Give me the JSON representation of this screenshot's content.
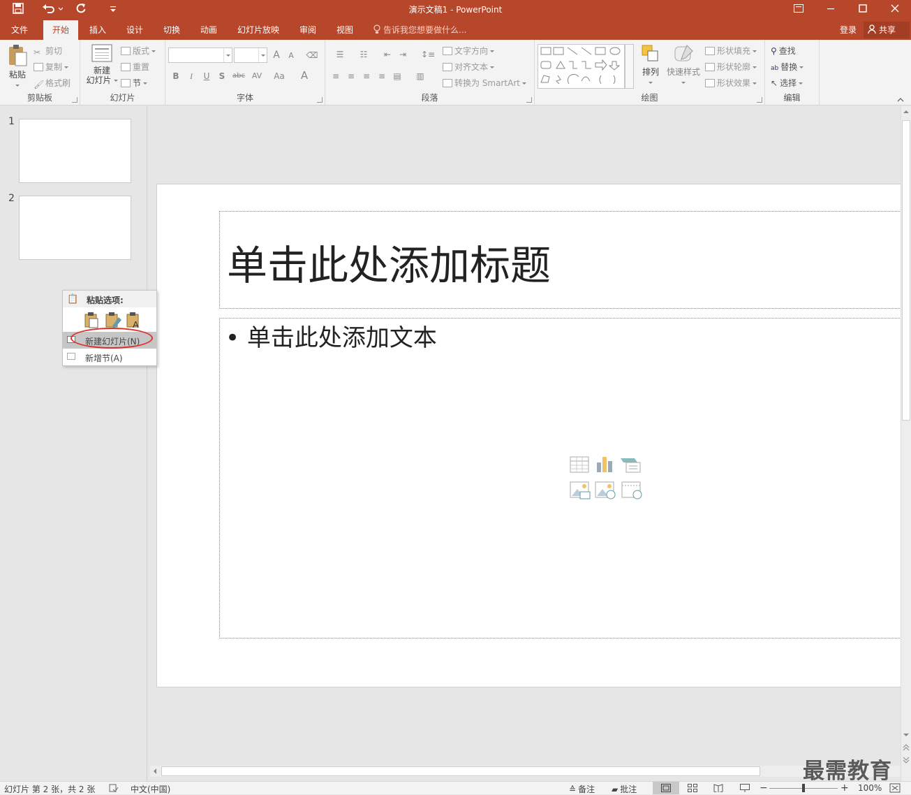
{
  "window": {
    "title": "演示文稿1 - PowerPoint"
  },
  "qat": {
    "save_icon": "save-icon",
    "undo_icon": "undo-icon",
    "redo_icon": "redo-icon",
    "customize_icon": "chevron-down-icon"
  },
  "tabs": [
    {
      "label": "文件"
    },
    {
      "label": "开始"
    },
    {
      "label": "插入"
    },
    {
      "label": "设计"
    },
    {
      "label": "切换"
    },
    {
      "label": "动画"
    },
    {
      "label": "幻灯片放映"
    },
    {
      "label": "审阅"
    },
    {
      "label": "视图"
    }
  ],
  "tellme": {
    "placeholder": "告诉我您想要做什么..."
  },
  "account": {
    "login": "登录",
    "share": "共享"
  },
  "ribbon": {
    "clipboard": {
      "label": "剪贴板",
      "paste": "粘贴",
      "cut": "剪切",
      "copy": "复制",
      "format_painter": "格式刷"
    },
    "slides": {
      "label": "幻灯片",
      "new_slide_line1": "新建",
      "new_slide_line2": "幻灯片",
      "layout": "版式",
      "reset": "重置",
      "section": "节"
    },
    "font": {
      "label": "字体",
      "bold": "B",
      "italic": "I",
      "underline": "U",
      "shadow": "S",
      "strike": "abc",
      "spacing": "AV",
      "case": "Aa",
      "color": "A",
      "grow": "A",
      "shrink": "A"
    },
    "paragraph": {
      "label": "段落",
      "text_direction": "文字方向",
      "align_text": "对齐文本",
      "smartart": "转换为 SmartArt"
    },
    "drawing": {
      "label": "绘图",
      "arrange": "排列",
      "quick_styles": "快速样式",
      "shape_fill": "形状填充",
      "shape_outline": "形状轮廓",
      "shape_effects": "形状效果"
    },
    "editing": {
      "label": "编辑",
      "find": "查找",
      "replace": "替换",
      "select": "选择"
    }
  },
  "slides_pane": {
    "thumbs": [
      {
        "num": "1"
      },
      {
        "num": "2"
      }
    ]
  },
  "slide": {
    "title_placeholder": "单击此处添加标题",
    "body_placeholder": "单击此处添加文本"
  },
  "context_menu": {
    "header": "粘贴选项:",
    "new_slide": "新建幻灯片(N)",
    "new_section": "新增节(A)"
  },
  "statusbar": {
    "slide_info": "幻灯片 第 2 张，共 2 张",
    "language": "中文(中国)",
    "notes": "备注",
    "comments": "批注",
    "zoom": "100%"
  },
  "watermark": "最需教育",
  "colors": {
    "accent": "#b7472a",
    "annotation": "#e0302a"
  }
}
